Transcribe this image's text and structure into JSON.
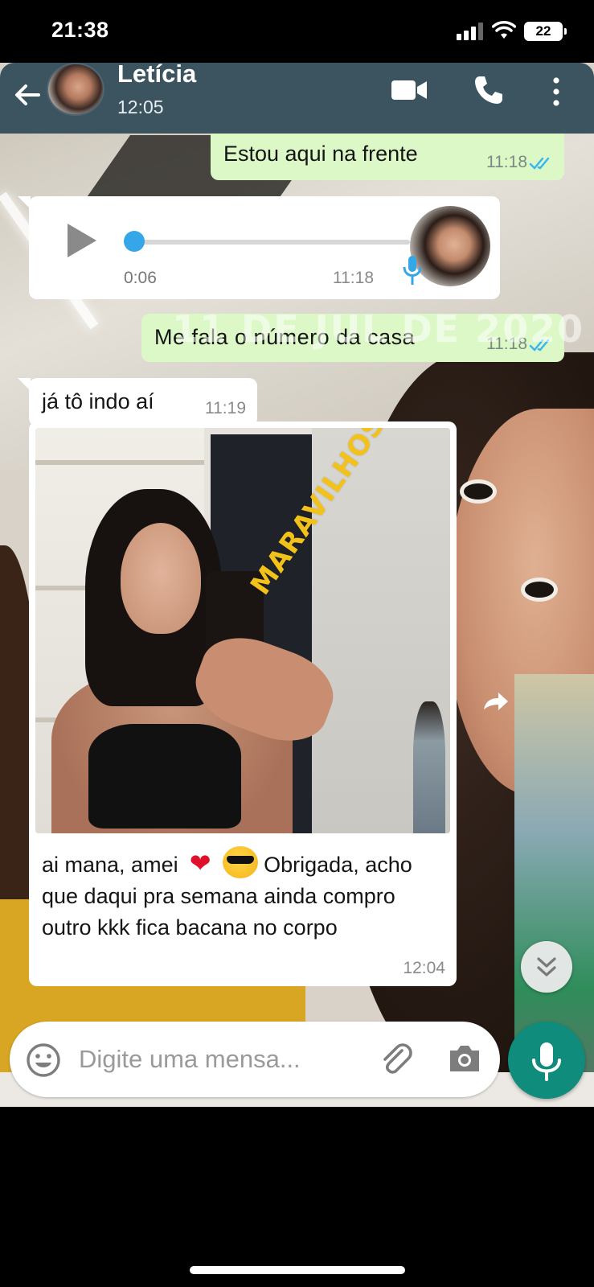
{
  "status_bar": {
    "time": "21:38",
    "battery": "22"
  },
  "header": {
    "contact_name": "Letícia",
    "last_seen": "12:05"
  },
  "messages": [
    {
      "direction": "out",
      "text": "Estou aqui na frente",
      "time": "11:18"
    },
    {
      "direction": "in",
      "type": "audio",
      "duration": "0:06",
      "time": "11:18"
    },
    {
      "direction": "out",
      "text": "Me fala o número da casa",
      "time": "11:18",
      "overlay": "11 DE JUL DE 2020"
    },
    {
      "direction": "in",
      "text": "já tô indo aí",
      "time": "11:19"
    },
    {
      "direction": "in",
      "type": "image",
      "watermark": "MARAVILHOSAA",
      "caption_part1": "ai mana, amei",
      "caption_part2": "Obrigada, acho que daqui pra semana ainda compro outro kkk fica bacana no corpo",
      "time": "12:04"
    }
  ],
  "composer": {
    "placeholder": "Digite uma mensa..."
  },
  "icons": {
    "back": "arrow-left-icon",
    "video": "video-camera-icon",
    "phone": "phone-icon",
    "menu": "more-vert-icon",
    "emoji": "smiley-icon",
    "attach": "paperclip-icon",
    "camera": "camera-icon",
    "mic": "microphone-icon"
  },
  "colors": {
    "header": "#3c5360",
    "outgoing": "#dcf8c6",
    "accent": "#0f8c7b",
    "audio_dot": "#35a6e8",
    "read_ticks": "#34b7f1"
  }
}
